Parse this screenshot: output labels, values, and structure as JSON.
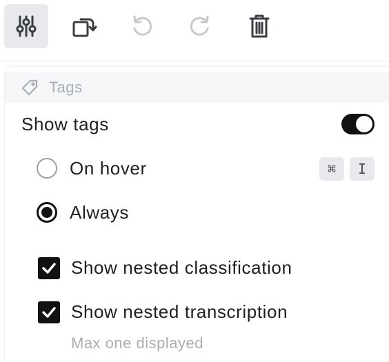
{
  "toolbar": {
    "buttons": [
      {
        "icon": "sliders-icon",
        "active": true
      },
      {
        "icon": "rotate-icon",
        "active": false
      },
      {
        "icon": "undo-icon",
        "active": false
      },
      {
        "icon": "redo-icon",
        "active": false
      },
      {
        "icon": "trash-icon",
        "active": false
      }
    ]
  },
  "panel": {
    "section": {
      "icon": "tag-icon",
      "label": "Tags"
    },
    "show_tags": {
      "label": "Show tags",
      "enabled": true
    },
    "display_mode": {
      "options": [
        {
          "label": "On hover",
          "selected": false,
          "shortcut": [
            "⌘",
            "I"
          ]
        },
        {
          "label": "Always",
          "selected": true
        }
      ]
    },
    "nested": {
      "classification": {
        "label": "Show nested classification",
        "checked": true
      },
      "transcription": {
        "label": "Show nested transcription",
        "checked": true
      },
      "helper": "Max one displayed"
    }
  },
  "colors": {
    "accent": "#0f1112",
    "muted_text": "#a9adb4",
    "active_button_bg": "#e8e9ec",
    "disabled_icon": "#c7c9cd"
  }
}
